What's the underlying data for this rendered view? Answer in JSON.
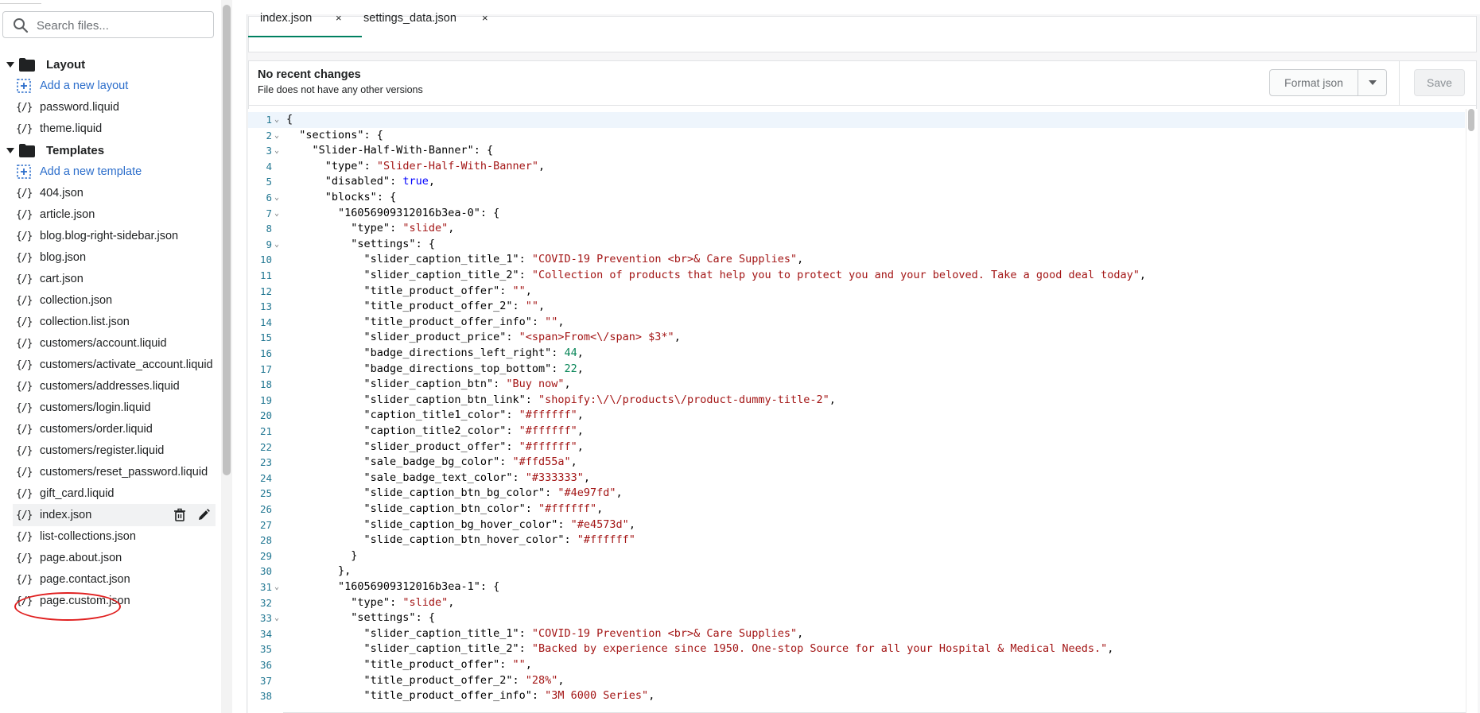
{
  "sidebar": {
    "search_placeholder": "Search files...",
    "rows": [
      {
        "kind": "folder",
        "label": "Layout"
      },
      {
        "kind": "add",
        "label": "Add a new layout"
      },
      {
        "kind": "file",
        "label": "password.liquid"
      },
      {
        "kind": "file",
        "label": "theme.liquid"
      },
      {
        "kind": "folder",
        "label": "Templates"
      },
      {
        "kind": "add",
        "label": "Add a new template"
      },
      {
        "kind": "file",
        "label": "404.json"
      },
      {
        "kind": "file",
        "label": "article.json"
      },
      {
        "kind": "file",
        "label": "blog.blog-right-sidebar.json"
      },
      {
        "kind": "file",
        "label": "blog.json"
      },
      {
        "kind": "file",
        "label": "cart.json"
      },
      {
        "kind": "file",
        "label": "collection.json"
      },
      {
        "kind": "file",
        "label": "collection.list.json"
      },
      {
        "kind": "file",
        "label": "customers/account.liquid"
      },
      {
        "kind": "file",
        "label": "customers/activate_account.liquid"
      },
      {
        "kind": "file",
        "label": "customers/addresses.liquid"
      },
      {
        "kind": "file",
        "label": "customers/login.liquid"
      },
      {
        "kind": "file",
        "label": "customers/order.liquid"
      },
      {
        "kind": "file",
        "label": "customers/register.liquid"
      },
      {
        "kind": "file",
        "label": "customers/reset_password.liquid"
      },
      {
        "kind": "file",
        "label": "gift_card.liquid"
      },
      {
        "kind": "file",
        "label": "index.json",
        "selected": true
      },
      {
        "kind": "file",
        "label": "list-collections.json"
      },
      {
        "kind": "file",
        "label": "page.about.json"
      },
      {
        "kind": "file",
        "label": "page.contact.json"
      },
      {
        "kind": "file",
        "label": "page.custom.json"
      }
    ],
    "file_icon_glyph": "{/}"
  },
  "tabs": [
    {
      "label": "index.json",
      "active": true,
      "close": "×"
    },
    {
      "label": "settings_data.json",
      "active": false,
      "close": "×"
    }
  ],
  "status": {
    "title": "No recent changes",
    "subtitle": "File does not have any other versions"
  },
  "toolbar": {
    "format_label": "Format json",
    "save_label": "Save"
  },
  "code": {
    "lines": [
      [
        [
          "p",
          "{"
        ]
      ],
      [
        [
          "p",
          "  "
        ],
        [
          "k",
          "\"sections\""
        ],
        [
          "p",
          ": {"
        ]
      ],
      [
        [
          "p",
          "    "
        ],
        [
          "k",
          "\"Slider-Half-With-Banner\""
        ],
        [
          "p",
          ": {"
        ]
      ],
      [
        [
          "p",
          "      "
        ],
        [
          "k",
          "\"type\""
        ],
        [
          "p",
          ": "
        ],
        [
          "s",
          "\"Slider-Half-With-Banner\""
        ],
        [
          "p",
          ","
        ]
      ],
      [
        [
          "p",
          "      "
        ],
        [
          "k",
          "\"disabled\""
        ],
        [
          "p",
          ": "
        ],
        [
          "b",
          "true"
        ],
        [
          "p",
          ","
        ]
      ],
      [
        [
          "p",
          "      "
        ],
        [
          "k",
          "\"blocks\""
        ],
        [
          "p",
          ": {"
        ]
      ],
      [
        [
          "p",
          "        "
        ],
        [
          "k",
          "\"16056909312016b3ea-0\""
        ],
        [
          "p",
          ": {"
        ]
      ],
      [
        [
          "p",
          "          "
        ],
        [
          "k",
          "\"type\""
        ],
        [
          "p",
          ": "
        ],
        [
          "s",
          "\"slide\""
        ],
        [
          "p",
          ","
        ]
      ],
      [
        [
          "p",
          "          "
        ],
        [
          "k",
          "\"settings\""
        ],
        [
          "p",
          ": {"
        ]
      ],
      [
        [
          "p",
          "            "
        ],
        [
          "k",
          "\"slider_caption_title_1\""
        ],
        [
          "p",
          ": "
        ],
        [
          "s",
          "\"COVID-19 Prevention <br>& Care Supplies\""
        ],
        [
          "p",
          ","
        ]
      ],
      [
        [
          "p",
          "            "
        ],
        [
          "k",
          "\"slider_caption_title_2\""
        ],
        [
          "p",
          ": "
        ],
        [
          "s",
          "\"Collection of products that help you to protect you and your beloved. Take a good deal today\""
        ],
        [
          "p",
          ","
        ]
      ],
      [
        [
          "p",
          "            "
        ],
        [
          "k",
          "\"title_product_offer\""
        ],
        [
          "p",
          ": "
        ],
        [
          "s",
          "\"\""
        ],
        [
          "p",
          ","
        ]
      ],
      [
        [
          "p",
          "            "
        ],
        [
          "k",
          "\"title_product_offer_2\""
        ],
        [
          "p",
          ": "
        ],
        [
          "s",
          "\"\""
        ],
        [
          "p",
          ","
        ]
      ],
      [
        [
          "p",
          "            "
        ],
        [
          "k",
          "\"title_product_offer_info\""
        ],
        [
          "p",
          ": "
        ],
        [
          "s",
          "\"\""
        ],
        [
          "p",
          ","
        ]
      ],
      [
        [
          "p",
          "            "
        ],
        [
          "k",
          "\"slider_product_price\""
        ],
        [
          "p",
          ": "
        ],
        [
          "s",
          "\"<span>From<\\/span> $3*\""
        ],
        [
          "p",
          ","
        ]
      ],
      [
        [
          "p",
          "            "
        ],
        [
          "k",
          "\"badge_directions_left_right\""
        ],
        [
          "p",
          ": "
        ],
        [
          "n",
          "44"
        ],
        [
          "p",
          ","
        ]
      ],
      [
        [
          "p",
          "            "
        ],
        [
          "k",
          "\"badge_directions_top_bottom\""
        ],
        [
          "p",
          ": "
        ],
        [
          "n",
          "22"
        ],
        [
          "p",
          ","
        ]
      ],
      [
        [
          "p",
          "            "
        ],
        [
          "k",
          "\"slider_caption_btn\""
        ],
        [
          "p",
          ": "
        ],
        [
          "s",
          "\"Buy now\""
        ],
        [
          "p",
          ","
        ]
      ],
      [
        [
          "p",
          "            "
        ],
        [
          "k",
          "\"slider_caption_btn_link\""
        ],
        [
          "p",
          ": "
        ],
        [
          "s",
          "\"shopify:\\/\\/products\\/product-dummy-title-2\""
        ],
        [
          "p",
          ","
        ]
      ],
      [
        [
          "p",
          "            "
        ],
        [
          "k",
          "\"caption_title1_color\""
        ],
        [
          "p",
          ": "
        ],
        [
          "s",
          "\"#ffffff\""
        ],
        [
          "p",
          ","
        ]
      ],
      [
        [
          "p",
          "            "
        ],
        [
          "k",
          "\"caption_title2_color\""
        ],
        [
          "p",
          ": "
        ],
        [
          "s",
          "\"#ffffff\""
        ],
        [
          "p",
          ","
        ]
      ],
      [
        [
          "p",
          "            "
        ],
        [
          "k",
          "\"slider_product_offer\""
        ],
        [
          "p",
          ": "
        ],
        [
          "s",
          "\"#ffffff\""
        ],
        [
          "p",
          ","
        ]
      ],
      [
        [
          "p",
          "            "
        ],
        [
          "k",
          "\"sale_badge_bg_color\""
        ],
        [
          "p",
          ": "
        ],
        [
          "s",
          "\"#ffd55a\""
        ],
        [
          "p",
          ","
        ]
      ],
      [
        [
          "p",
          "            "
        ],
        [
          "k",
          "\"sale_badge_text_color\""
        ],
        [
          "p",
          ": "
        ],
        [
          "s",
          "\"#333333\""
        ],
        [
          "p",
          ","
        ]
      ],
      [
        [
          "p",
          "            "
        ],
        [
          "k",
          "\"slide_caption_btn_bg_color\""
        ],
        [
          "p",
          ": "
        ],
        [
          "s",
          "\"#4e97fd\""
        ],
        [
          "p",
          ","
        ]
      ],
      [
        [
          "p",
          "            "
        ],
        [
          "k",
          "\"slide_caption_btn_color\""
        ],
        [
          "p",
          ": "
        ],
        [
          "s",
          "\"#ffffff\""
        ],
        [
          "p",
          ","
        ]
      ],
      [
        [
          "p",
          "            "
        ],
        [
          "k",
          "\"slide_caption_bg_hover_color\""
        ],
        [
          "p",
          ": "
        ],
        [
          "s",
          "\"#e4573d\""
        ],
        [
          "p",
          ","
        ]
      ],
      [
        [
          "p",
          "            "
        ],
        [
          "k",
          "\"slide_caption_btn_hover_color\""
        ],
        [
          "p",
          ": "
        ],
        [
          "s",
          "\"#ffffff\""
        ]
      ],
      [
        [
          "p",
          "          }"
        ]
      ],
      [
        [
          "p",
          "        },"
        ]
      ],
      [
        [
          "p",
          "        "
        ],
        [
          "k",
          "\"16056909312016b3ea-1\""
        ],
        [
          "p",
          ": {"
        ]
      ],
      [
        [
          "p",
          "          "
        ],
        [
          "k",
          "\"type\""
        ],
        [
          "p",
          ": "
        ],
        [
          "s",
          "\"slide\""
        ],
        [
          "p",
          ","
        ]
      ],
      [
        [
          "p",
          "          "
        ],
        [
          "k",
          "\"settings\""
        ],
        [
          "p",
          ": {"
        ]
      ],
      [
        [
          "p",
          "            "
        ],
        [
          "k",
          "\"slider_caption_title_1\""
        ],
        [
          "p",
          ": "
        ],
        [
          "s",
          "\"COVID-19 Prevention <br>& Care Supplies\""
        ],
        [
          "p",
          ","
        ]
      ],
      [
        [
          "p",
          "            "
        ],
        [
          "k",
          "\"slider_caption_title_2\""
        ],
        [
          "p",
          ": "
        ],
        [
          "s",
          "\"Backed by experience since 1950. One-stop Source for all your Hospital & Medical Needs.\""
        ],
        [
          "p",
          ","
        ]
      ],
      [
        [
          "p",
          "            "
        ],
        [
          "k",
          "\"title_product_offer\""
        ],
        [
          "p",
          ": "
        ],
        [
          "s",
          "\"\""
        ],
        [
          "p",
          ","
        ]
      ],
      [
        [
          "p",
          "            "
        ],
        [
          "k",
          "\"title_product_offer_2\""
        ],
        [
          "p",
          ": "
        ],
        [
          "s",
          "\"28%\""
        ],
        [
          "p",
          ","
        ]
      ],
      [
        [
          "p",
          "            "
        ],
        [
          "k",
          "\"title_product_offer_info\""
        ],
        [
          "p",
          ": "
        ],
        [
          "s",
          "\"3M 6000 Series\""
        ],
        [
          "p",
          ","
        ]
      ]
    ],
    "foldable": [
      1,
      2,
      3,
      6,
      7,
      9,
      31,
      33
    ],
    "current_line": 1
  },
  "colors": {
    "accent_tab": "#008060",
    "link": "#2c6ecb",
    "annotation": "#e02020",
    "string": "#a31515",
    "number": "#098658",
    "keyword": "#0000ff"
  }
}
